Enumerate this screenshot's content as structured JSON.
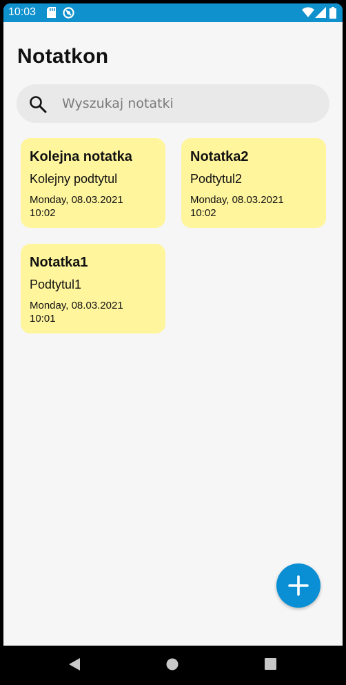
{
  "status_bar": {
    "time": "10:03",
    "icons": [
      "sd-card-icon",
      "sync-icon",
      "wifi-icon",
      "signal-icon",
      "battery-icon"
    ],
    "background_color": "#0f91cd"
  },
  "app": {
    "title": "Notatkon"
  },
  "search": {
    "placeholder": "Wyszukaj notatki",
    "value": "",
    "icon": "search-icon"
  },
  "notes": [
    {
      "title": "Kolejna notatka",
      "subtitle": "Kolejny podtytul",
      "date": "Monday, 08.03.2021",
      "time": "10:02"
    },
    {
      "title": "Notatka2",
      "subtitle": "Podtytul2",
      "date": "Monday, 08.03.2021",
      "time": "10:02"
    },
    {
      "title": "Notatka1",
      "subtitle": "Podtytul1",
      "date": "Monday, 08.03.2021",
      "time": "10:01"
    }
  ],
  "colors": {
    "note_card": "#fff59d",
    "fab": "#0b8fd4",
    "background": "#f6f6f6"
  },
  "fab": {
    "icon": "plus-icon"
  },
  "navigation_bar": {
    "buttons": [
      "back-icon",
      "home-icon",
      "recents-icon"
    ]
  }
}
